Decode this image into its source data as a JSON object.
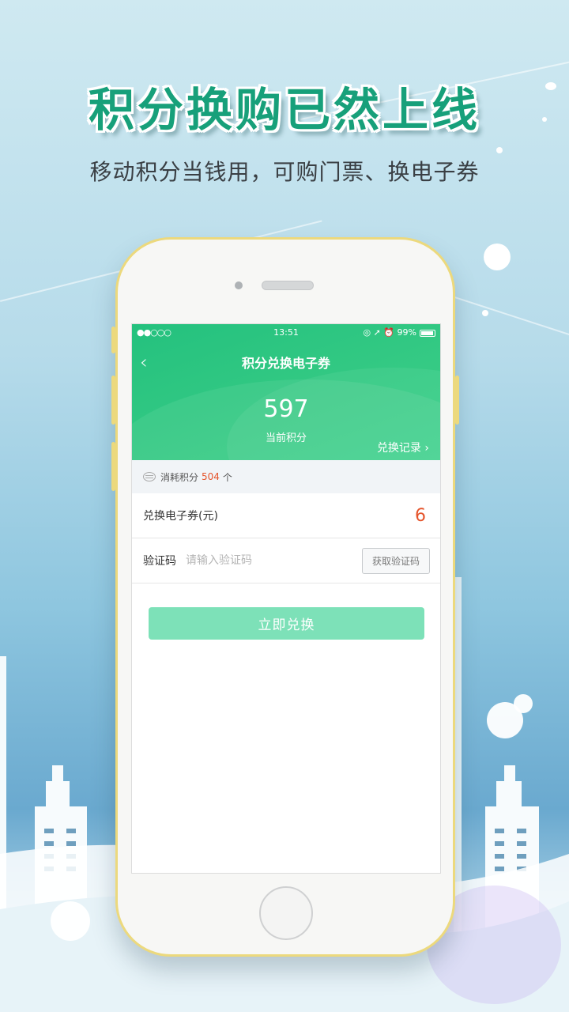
{
  "promo": {
    "headline": "积分换购已然上线",
    "subheadline": "移动积分当钱用，可购门票、换电子券"
  },
  "status_bar": {
    "signal": "●●○○○",
    "time": "13:51",
    "icons": "◎ ➚ ⏰ 99%",
    "battery_percent": "99%"
  },
  "nav": {
    "back_icon": "chevron-left-icon",
    "title": "积分兑换电子券"
  },
  "points": {
    "current_value": "597",
    "current_label": "当前积分",
    "records_link": "兑换记录 ›"
  },
  "consume": {
    "label": "消耗积分",
    "value": "504",
    "unit": "个"
  },
  "form": {
    "voucher_label": "兑换电子券(元)",
    "voucher_amount": "6",
    "code_label": "验证码",
    "code_placeholder": "请输入验证码",
    "get_code_button": "获取验证码",
    "submit_button": "立即兑换"
  },
  "colors": {
    "header_green": "#2fc782",
    "accent_red": "#e5542b",
    "button_green_disabled": "#7de1b8",
    "phone_frame": "#ecd97d"
  }
}
